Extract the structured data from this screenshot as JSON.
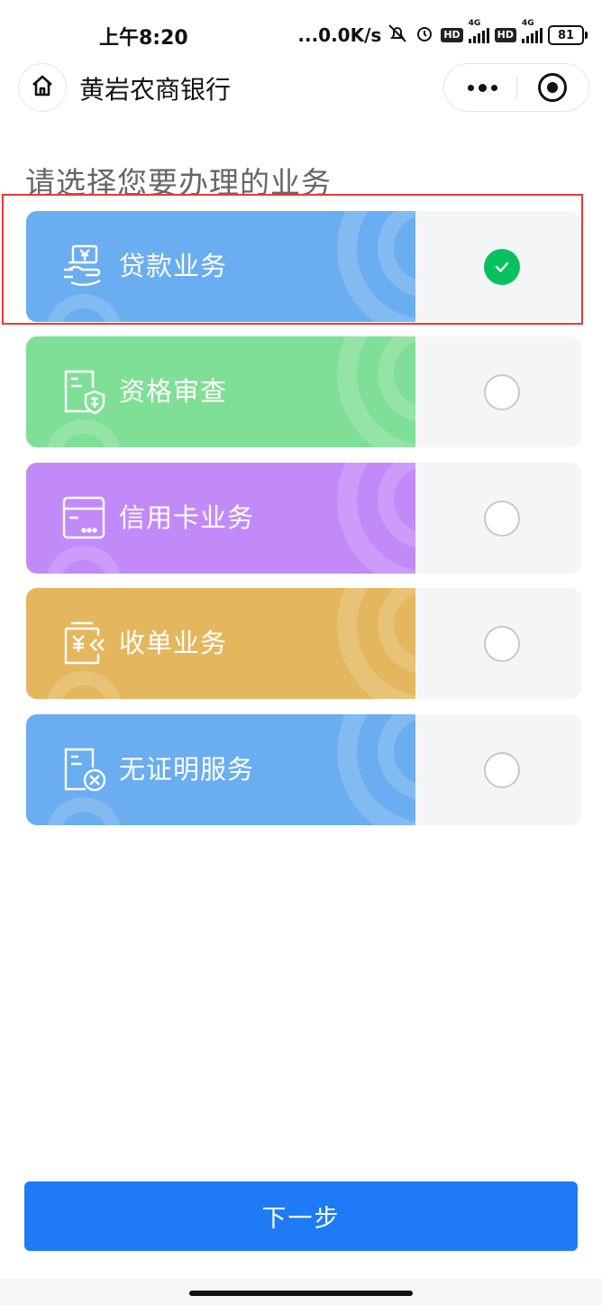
{
  "status_bar": {
    "time": "上午8:20",
    "net_speed": "...0.0K/s",
    "hd_badge_1": "HD",
    "hd_badge_2": "HD",
    "signal_1_label": "4G",
    "signal_2_label": "4G",
    "battery": "81"
  },
  "nav": {
    "title": "黄岩农商银行"
  },
  "page": {
    "heading": "请选择您要办理的业务"
  },
  "options": [
    {
      "label": "贷款业务",
      "icon": "loan-yuan-icon",
      "color": "#6aadf0",
      "selected": true
    },
    {
      "label": "资格审查",
      "icon": "qualification-shield-icon",
      "color": "#7fdf96",
      "selected": false
    },
    {
      "label": "信用卡业务",
      "icon": "credit-card-icon",
      "color": "#c28af9",
      "selected": false
    },
    {
      "label": "收单业务",
      "icon": "acquiring-yuan-icon",
      "color": "#e4b75e",
      "selected": false
    },
    {
      "label": "无证明服务",
      "icon": "no-proof-document-icon",
      "color": "#6aadf0",
      "selected": false
    }
  ],
  "footer": {
    "next_label": "下一步"
  },
  "colors": {
    "primary": "#1e7bf5",
    "check_green": "#07c160",
    "highlight_red": "#e83a3a"
  }
}
